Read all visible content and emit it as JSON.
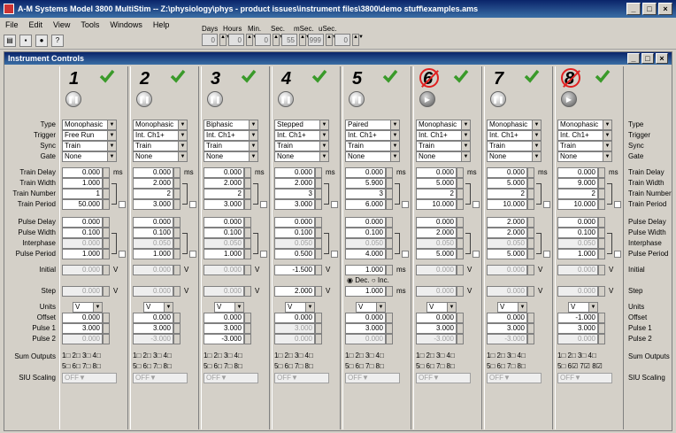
{
  "title": "A-M Systems Model 3800 MultiStim -- Z:\\physiology\\phys - product issues\\instrument files\\3800\\demo stuff\\examples.ams",
  "menu": [
    "File",
    "Edit",
    "View",
    "Tools",
    "Windows",
    "Help"
  ],
  "time_labels": [
    "Days",
    "Hours",
    "Min.",
    "Sec.",
    "mSec.",
    "uSec."
  ],
  "time_values": [
    "0",
    "0",
    "0",
    "55",
    "999",
    "0"
  ],
  "child_title": "Instrument Controls",
  "row_labels": [
    "Type",
    "Trigger",
    "Sync",
    "Gate",
    "Train Delay",
    "Train Width",
    "Train Number",
    "Train Period",
    "Pulse Delay",
    "Pulse Width",
    "Interphase",
    "Pulse Period",
    "Initial",
    "Step",
    "Units",
    "Offset",
    "Pulse 1",
    "Pulse 2",
    "Sum Outputs",
    "SIU Scaling"
  ],
  "channels": [
    {
      "num": "1",
      "disabled": false,
      "type": "Monophasic",
      "trigger": "Free Run",
      "sync": "Train",
      "gate": "None",
      "train_delay": "0.000",
      "train_width": "1.000",
      "train_number": "1",
      "train_period": "50.000",
      "pulse_delay": "0.000",
      "pulse_width": "0.100",
      "interphase": "0.000",
      "pulse_period": "1.000",
      "initial": "0.000",
      "step": "0.000",
      "units": "V",
      "offset": "0.000",
      "pulse1": "3.000",
      "pulse2": "0.000",
      "sum_a": "1□ 2□ 3□ 4□",
      "sum_b": "5□ 6□ 7□ 8□",
      "siu": "OFF"
    },
    {
      "num": "2",
      "disabled": false,
      "type": "Monophasic",
      "trigger": "Int. Ch1+",
      "sync": "Train",
      "gate": "None",
      "train_delay": "0.000",
      "train_width": "2.000",
      "train_number": "2",
      "train_period": "3.000",
      "pulse_delay": "0.000",
      "pulse_width": "0.100",
      "interphase": "0.050",
      "pulse_period": "1.000",
      "initial": "0.000",
      "step": "0.000",
      "units": "V",
      "offset": "0.000",
      "pulse1": "3.000",
      "pulse2": "-3.000",
      "sum_a": "1□ 2□ 3□ 4□",
      "sum_b": "5□ 6□ 7□ 8□",
      "siu": "OFF"
    },
    {
      "num": "3",
      "disabled": false,
      "type": "Biphasic",
      "trigger": "Int. Ch1+",
      "sync": "Train",
      "gate": "None",
      "train_delay": "0.000",
      "train_width": "2.000",
      "train_number": "2",
      "train_period": "3.000",
      "pulse_delay": "0.000",
      "pulse_width": "0.100",
      "interphase": "0.050",
      "pulse_period": "1.000",
      "initial": "0.000",
      "step": "0.000",
      "units": "V",
      "offset": "0.000",
      "pulse1": "3.000",
      "pulse2": "-3.000",
      "sum_a": "1□ 2□ 3□ 4□",
      "sum_b": "5□ 6□ 7□ 8□",
      "siu": "OFF"
    },
    {
      "num": "4",
      "disabled": false,
      "type": "Stepped",
      "trigger": "Int. Ch1+",
      "sync": "Train",
      "gate": "None",
      "train_delay": "0.000",
      "train_width": "2.000",
      "train_number": "3",
      "train_period": "3.000",
      "pulse_delay": "0.000",
      "pulse_width": "0.100",
      "interphase": "0.050",
      "pulse_period": "0.500",
      "initial": "-1.500",
      "step": "2.000",
      "units": "V",
      "offset": "0.000",
      "pulse1": "3.000",
      "pulse2": "0.000",
      "sum_a": "1□ 2□ 3□ 4□",
      "sum_b": "5□ 6□ 7□ 8□",
      "siu": "OFF"
    },
    {
      "num": "5",
      "disabled": false,
      "type": "Paired",
      "trigger": "Int. Ch1+",
      "sync": "Train",
      "gate": "None",
      "train_delay": "0.000",
      "train_width": "5.900",
      "train_number": "3",
      "train_period": "6.000",
      "pulse_delay": "0.000",
      "pulse_width": "0.100",
      "interphase": "0.050",
      "pulse_period": "4.000",
      "initial": "1.000",
      "step": "1.000",
      "units": "V",
      "offset": "0.000",
      "pulse1": "3.000",
      "pulse2": "0.000",
      "sum_a": "1□ 2□ 3□ 4□",
      "sum_b": "5□ 6□ 7□ 8□",
      "siu": "OFF"
    },
    {
      "num": "6",
      "disabled": true,
      "type": "Monophasic",
      "trigger": "Int. Ch1+",
      "sync": "Train",
      "gate": "None",
      "train_delay": "0.000",
      "train_width": "5.000",
      "train_number": "2",
      "train_period": "10.000",
      "pulse_delay": "0.000",
      "pulse_width": "2.000",
      "interphase": "0.050",
      "pulse_period": "5.000",
      "initial": "0.000",
      "step": "0.000",
      "units": "V",
      "offset": "0.000",
      "pulse1": "3.000",
      "pulse2": "-3.000",
      "sum_a": "1□ 2□ 3□ 4□",
      "sum_b": "5□ 6□ 7□ 8□",
      "siu": "OFF"
    },
    {
      "num": "7",
      "disabled": false,
      "type": "Monophasic",
      "trigger": "Int. Ch1+",
      "sync": "Train",
      "gate": "None",
      "train_delay": "0.000",
      "train_width": "5.000",
      "train_number": "2",
      "train_period": "10.000",
      "pulse_delay": "2.000",
      "pulse_width": "2.000",
      "interphase": "0.050",
      "pulse_period": "5.000",
      "initial": "0.000",
      "step": "0.000",
      "units": "V",
      "offset": "0.000",
      "pulse1": "3.000",
      "pulse2": "-3.000",
      "sum_a": "1□ 2□ 3□ 4□",
      "sum_b": "5□ 6□ 7□ 8□",
      "siu": "OFF"
    },
    {
      "num": "8",
      "disabled": true,
      "type": "Monophasic",
      "trigger": "Int. Ch1+",
      "sync": "Train",
      "gate": "None",
      "train_delay": "0.000",
      "train_width": "9.000",
      "train_number": "2",
      "train_period": "10.000",
      "pulse_delay": "0.000",
      "pulse_width": "0.100",
      "interphase": "0.050",
      "pulse_period": "1.000",
      "initial": "0.000",
      "step": "0.000",
      "units": "V",
      "offset": "-1.000",
      "pulse1": "3.000",
      "pulse2": "0.000",
      "sum_a": "1□ 2□ 3□ 4□",
      "sum_b": "5□ 6☑ 7☑ 8☑",
      "siu": "OFF"
    }
  ],
  "unit_ms": "ms",
  "unit_v": "V",
  "dec_label": "Dec.",
  "inc_label": "Inc."
}
